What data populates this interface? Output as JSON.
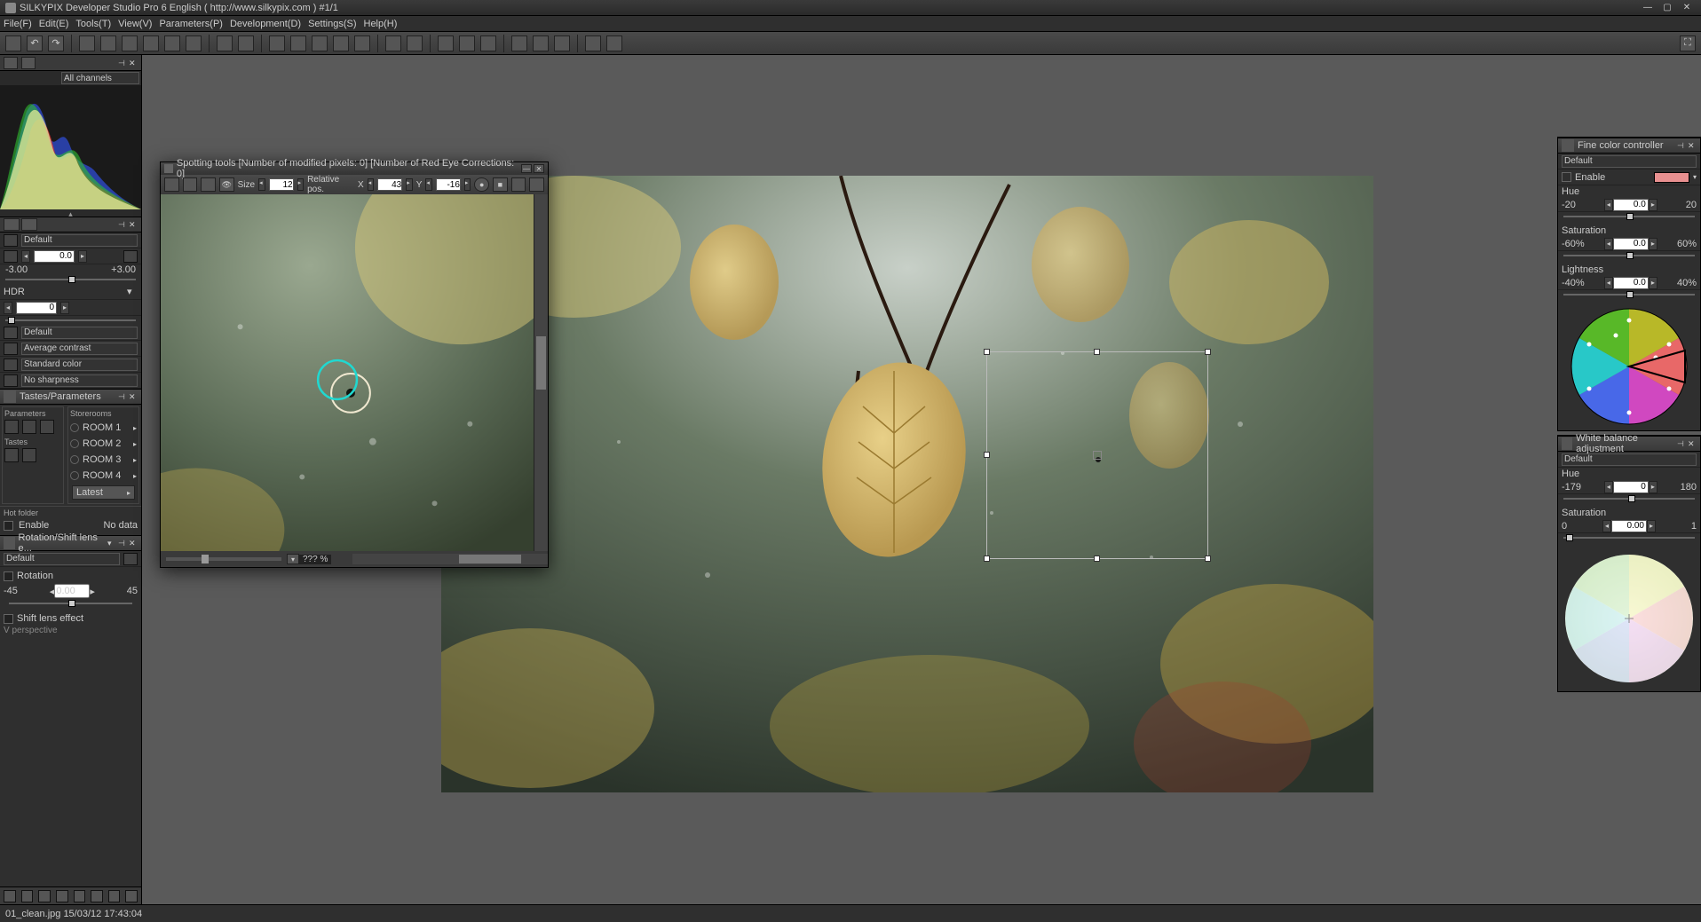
{
  "title": "SILKYPIX Developer Studio Pro 6 English ( http://www.silkypix.com )   #1/1",
  "menu": [
    "File(F)",
    "Edit(E)",
    "Tools(T)",
    "View(V)",
    "Parameters(P)",
    "Development(D)",
    "Settings(S)",
    "Help(H)"
  ],
  "histogram": {
    "channel_label": "All channels"
  },
  "exposure": {
    "preset": "Default",
    "ev_value": "0.0",
    "ev_min": "-3.00",
    "ev_max": "+3.00",
    "hdr_label": "HDR",
    "hdr_value": "0"
  },
  "adjustments": {
    "preset": "Default",
    "contrast": "Average contrast",
    "color": "Standard color",
    "sharpness": "No sharpness"
  },
  "tastes": {
    "title": "Tastes/Parameters",
    "params_label": "Parameters",
    "storerooms_label": "Storerooms",
    "tastes_label": "Tastes",
    "rooms": [
      "ROOM 1",
      "ROOM 2",
      "ROOM 3",
      "ROOM 4"
    ],
    "latest": "Latest"
  },
  "hot": {
    "label": "Hot folder",
    "enable": "Enable",
    "nodata": "No data"
  },
  "rotation": {
    "title": "Rotation/Shift lens e...",
    "preset": "Default",
    "cb_rotation": "Rotation",
    "rot_min": "-45",
    "rot_max": "45",
    "rot_val": "0.00",
    "cb_shift": "Shift lens effect",
    "vpersp": "V perspective"
  },
  "spotting": {
    "title": "Spotting tools [Number of modified pixels: 0]   [Number of Red Eye Corrections: 0]",
    "size_label": "Size",
    "size_val": "12",
    "rel_label": "Relative pos.",
    "x_label": "X",
    "x_val": "43",
    "y_label": "Y",
    "y_val": "-16",
    "zoom": "???  %"
  },
  "fine_color": {
    "title": "Fine color controller",
    "preset": "Default",
    "enable": "Enable",
    "hue_label": "Hue",
    "hue_min": "-20",
    "hue_max": "20",
    "hue_val": "0.0",
    "sat_label": "Saturation",
    "sat_min": "-60%",
    "sat_max": "60%",
    "sat_val": "0.0",
    "light_label": "Lightness",
    "light_min": "-40%",
    "light_max": "40%",
    "light_val": "0.0"
  },
  "wb": {
    "title": "White balance adjustment",
    "preset": "Default",
    "hue_label": "Hue",
    "hue_min": "-179",
    "hue_max": "180",
    "hue_val": "0",
    "sat_label": "Saturation",
    "sat_min": "0",
    "sat_max": "1",
    "sat_val": "0.00"
  },
  "status": "01_clean.jpg 15/03/12 17:43:04"
}
